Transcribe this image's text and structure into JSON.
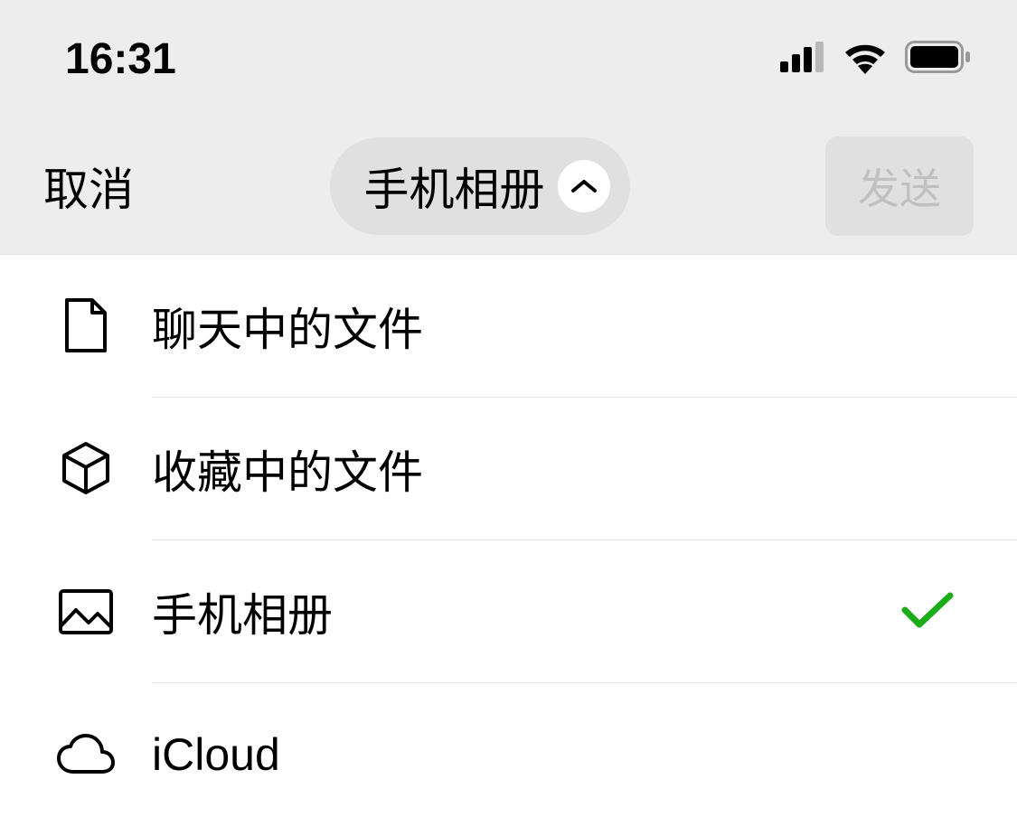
{
  "statusBar": {
    "time": "16:31"
  },
  "navBar": {
    "cancel": "取消",
    "title": "手机相册",
    "send": "发送"
  },
  "list": {
    "items": [
      {
        "label": "聊天中的文件",
        "selected": false
      },
      {
        "label": "收藏中的文件",
        "selected": false
      },
      {
        "label": "手机相册",
        "selected": true
      },
      {
        "label": "iCloud",
        "selected": false
      }
    ]
  }
}
